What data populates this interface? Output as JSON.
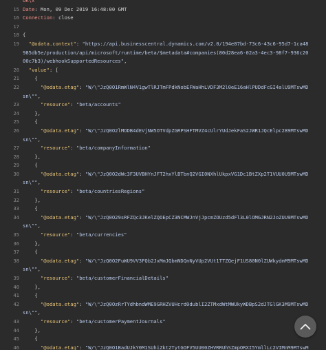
{
  "header_lines": [
    {
      "num": "",
      "key": "OK\\x",
      "sep": "",
      "value": ""
    },
    {
      "num": "15",
      "key": "Date",
      "sep": ": ",
      "value": "Mon, 09 Dec 2019 16:48:00 GMT"
    },
    {
      "num": "16",
      "key": "Connection",
      "sep": ": ",
      "value": "close"
    },
    {
      "num": "17",
      "key": "",
      "sep": "",
      "value": ""
    }
  ],
  "json_open": {
    "num": "18",
    "text": "{"
  },
  "context": {
    "num": "19",
    "key": "\"@odata.context\"",
    "value": "\"https://api.businesscentral.dynamics.com/v2.0/194e87bd-73c6-43c6-95d7-1ca48985db5e/production/api/microsoft/runtime/beta/$metadata#companies(80d28ea6-02a3-4ec3-98f7-936c2000c7b3)/webhookSupportedResources\""
  },
  "value_open": {
    "num": "20",
    "key": "\"value\"",
    "text": "["
  },
  "items": [
    {
      "open": "21",
      "etag_num": "22",
      "etag": "\"W/\\\"JzQ0O1RmWlN4V1gwTlRJTmFPdkNobEFWaHhLVDF3M2l0eE16aHlPUDdFcGI4alU9MTswMDsn\\\"\"",
      "res_num": "23",
      "resource": "\"beta/accounts\"",
      "close": "24"
    },
    {
      "open": "25",
      "etag_num": "26",
      "etag": "\"W/\\\"JzQ0O2lMODB4dEVjNW5OTVdpZGRPSHFTMVZ4cUlrYUdJekFaS2JWR1JQcElpc289MTswMDsn\\\"\"",
      "res_num": "27",
      "resource": "\"beta/companyInformation\"",
      "close": "28"
    },
    {
      "open": "29",
      "etag_num": "30",
      "etag": "\"W/\\\"JzQ0O2dWc3F3UVBHYnJFT2hxYlBTbnQ2VGI0NXhlUkpxVG1Dc1BtZXp2T1VUU0U9MTswMDsn\\\"\"",
      "res_num": "31",
      "resource": "\"beta/countriesRegions\"",
      "close": "32"
    },
    {
      "open": "33",
      "etag_num": "34",
      "etag": "\"W/\\\"JzQ0O29sRFZQc3JKelZQOEpCZ3NCMWJnVjJpcmZOUzd5dFl3L0lOMGJRN2JoZUU9MTswMDsn\\\"\"",
      "res_num": "35",
      "resource": "\"beta/currencies\"",
      "close": "36"
    },
    {
      "open": "37",
      "etag_num": "38",
      "etag": "\"W/\\\"JzQ0O2FuWU9VV3FQb2JxMmJQbmNDQnNyVUp2VUt1TTZQejF1US80N0lZUWkydmM9MTswMDsn\\\"\"",
      "res_num": "39",
      "resource": "\"beta/customerFinancialDetails\"",
      "close": "40"
    },
    {
      "open": "41",
      "etag_num": "42",
      "etag": "\"W/\\\"JzQ0OzRrTYdhbndWME9GRHZVUHcrd0dublI2ZTMxdWtMWUkyWDBpS2dJTGlGK3M9MTswMDsn\\\"\"",
      "res_num": "43",
      "resource": "\"beta/customerPaymentJournals\"",
      "close": "44"
    },
    {
      "open": "45",
      "etag_num": "46",
      "etag": "\"W/\\\"JzQ0O1BadUJkY0M1SUhiZkt2TytGOFV5UU00ZHVRRUhSZmpORXI5YmllLc2VIMnM9MTswMDsn\\\"\"",
      "res_num": "",
      "resource": "",
      "close": ""
    }
  ],
  "etag_key": "\"@odata.etag\"",
  "resource_key": "\"resource\"",
  "colors": {
    "background": "#2b2b2b",
    "line_number": "#8a8a8a",
    "json_key": "#e8c47a",
    "json_string": "#b8c9e8",
    "header_key": "#ef8f86"
  },
  "scroll_top_icon": "chevron-up-icon"
}
